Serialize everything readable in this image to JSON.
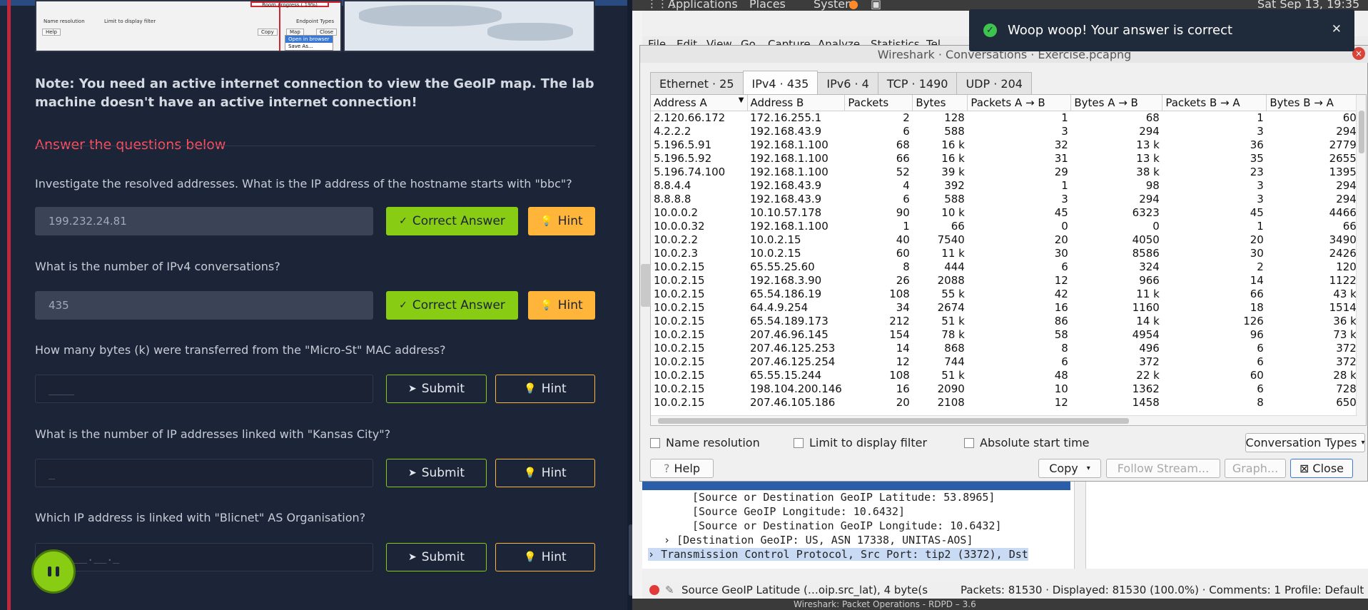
{
  "room": {
    "progress_label": "Room progress ( 19%)",
    "note": "Note: You need an active internet connection to view the GeoIP map. The lab machine doesn't have an active internet connection!",
    "section_title": "Answer the questions below",
    "screenshot_labels": {
      "name_resolution": "Name resolution",
      "limit_filter": "Limit to display filter",
      "endpoint_types": "Endpoint Types",
      "help": "Help",
      "copy": "Copy",
      "map": "Map",
      "close": "Close",
      "open_in_browser": "Open in browser",
      "save_as": "Save As..."
    },
    "questions": [
      {
        "text": "Investigate the resolved addresses. What is the IP address of the hostname starts with \"bbc\"?",
        "answer": "199.232.24.81",
        "button": "Correct Answer",
        "hint": "Hint"
      },
      {
        "text": "What is the number of IPv4 conversations?",
        "answer": "435",
        "button": "Correct Answer",
        "hint": "Hint"
      },
      {
        "text": "How many bytes (k) were transferred from the \"Micro-St\" MAC address?",
        "placeholder": "____",
        "button": "Submit",
        "hint": "Hint"
      },
      {
        "text": "What is the number of IP addresses linked with \"Kansas City\"?",
        "placeholder": "_",
        "button": "Submit",
        "hint": "Hint"
      },
      {
        "text": "Which IP address is linked with \"Blicnet\" AS Organisation?",
        "placeholder": "__.___.__._",
        "button": "Submit",
        "hint": "Hint"
      }
    ]
  },
  "system": {
    "applications": "Applications",
    "places": "Places",
    "system": "System",
    "clock": "Sat Sep 13, 19:35"
  },
  "wireshark": {
    "menu": [
      "File",
      "Edit",
      "View",
      "Go",
      "Capture",
      "Analyze",
      "Statistics",
      "Tel"
    ],
    "dialog_title": "Wireshark · Conversations · Exercise.pcapng",
    "tabs": [
      "Ethernet · 25",
      "IPv4 · 435",
      "IPv6 · 4",
      "TCP · 1490",
      "UDP · 204"
    ],
    "columns": [
      "Address A",
      "Address B",
      "Packets",
      "Bytes",
      "Packets A → B",
      "Bytes A → B",
      "Packets B → A",
      "Bytes B → A"
    ],
    "rows": [
      [
        "2.120.66.172",
        "172.16.255.1",
        "2",
        "128",
        "1",
        "68",
        "1",
        "60"
      ],
      [
        "4.2.2.2",
        "192.168.43.9",
        "6",
        "588",
        "3",
        "294",
        "3",
        "294"
      ],
      [
        "5.196.5.91",
        "192.168.1.100",
        "68",
        "16 k",
        "32",
        "13 k",
        "36",
        "2779"
      ],
      [
        "5.196.5.92",
        "192.168.1.100",
        "66",
        "16 k",
        "31",
        "13 k",
        "35",
        "2655"
      ],
      [
        "5.196.74.100",
        "192.168.1.100",
        "52",
        "39 k",
        "29",
        "38 k",
        "23",
        "1395"
      ],
      [
        "8.8.4.4",
        "192.168.43.9",
        "4",
        "392",
        "1",
        "98",
        "3",
        "294"
      ],
      [
        "8.8.8.8",
        "192.168.43.9",
        "6",
        "588",
        "3",
        "294",
        "3",
        "294"
      ],
      [
        "10.0.0.2",
        "10.10.57.178",
        "90",
        "10 k",
        "45",
        "6323",
        "45",
        "4466"
      ],
      [
        "10.0.0.32",
        "192.168.1.100",
        "1",
        "66",
        "0",
        "0",
        "1",
        "66"
      ],
      [
        "10.0.2.2",
        "10.0.2.15",
        "40",
        "7540",
        "20",
        "4050",
        "20",
        "3490"
      ],
      [
        "10.0.2.3",
        "10.0.2.15",
        "60",
        "11 k",
        "30",
        "8586",
        "30",
        "2426"
      ],
      [
        "10.0.2.15",
        "65.55.25.60",
        "8",
        "444",
        "6",
        "324",
        "2",
        "120"
      ],
      [
        "10.0.2.15",
        "192.168.3.90",
        "26",
        "2088",
        "12",
        "966",
        "14",
        "1122"
      ],
      [
        "10.0.2.15",
        "65.54.186.19",
        "108",
        "55 k",
        "42",
        "11 k",
        "66",
        "43 k"
      ],
      [
        "10.0.2.15",
        "64.4.9.254",
        "34",
        "2674",
        "16",
        "1160",
        "18",
        "1514"
      ],
      [
        "10.0.2.15",
        "65.54.189.173",
        "212",
        "51 k",
        "86",
        "14 k",
        "126",
        "36 k"
      ],
      [
        "10.0.2.15",
        "207.46.96.145",
        "154",
        "78 k",
        "58",
        "4954",
        "96",
        "73 k"
      ],
      [
        "10.0.2.15",
        "207.46.125.253",
        "14",
        "868",
        "8",
        "496",
        "6",
        "372"
      ],
      [
        "10.0.2.15",
        "207.46.125.254",
        "12",
        "744",
        "6",
        "372",
        "6",
        "372"
      ],
      [
        "10.0.2.15",
        "65.55.15.244",
        "108",
        "51 k",
        "48",
        "22 k",
        "60",
        "28 k"
      ],
      [
        "10.0.2.15",
        "198.104.200.146",
        "16",
        "2090",
        "10",
        "1362",
        "6",
        "728"
      ],
      [
        "10.0.2.15",
        "207.46.105.186",
        "20",
        "2108",
        "12",
        "1458",
        "8",
        "650"
      ]
    ],
    "options": {
      "name_resolution": "Name resolution",
      "limit_filter": "Limit to display filter",
      "absolute_time": "Absolute start time",
      "conv_types": "Conversation Types"
    },
    "buttons": {
      "help": "Help",
      "copy": "Copy",
      "follow_stream": "Follow Stream...",
      "graph": "Graph...",
      "close": "Close"
    },
    "detail_lines": [
      "[Source or Destination GeoIP Latitude: 53.8965]",
      "[Source GeoIP Longitude: 10.6432]",
      "[Source or Destination GeoIP Longitude: 10.6432]",
      "[Destination GeoIP: US, ASN 17338, UNITAS-AOS]",
      "Transmission Control Protocol, Src Port: tip2 (3372), Dst"
    ],
    "status": {
      "field": "Source GeoIP Latitude (…oip.src_lat), 4 byte(s",
      "packets": "Packets: 81530 · Displayed: 81530 (100.0%) · Comments: 1",
      "profile": "Profile: Default"
    },
    "taskbar_item": "Wireshark: Packet Operations - RDPD – 3.6"
  },
  "toast": {
    "message": "Woop woop! Your answer is correct"
  }
}
